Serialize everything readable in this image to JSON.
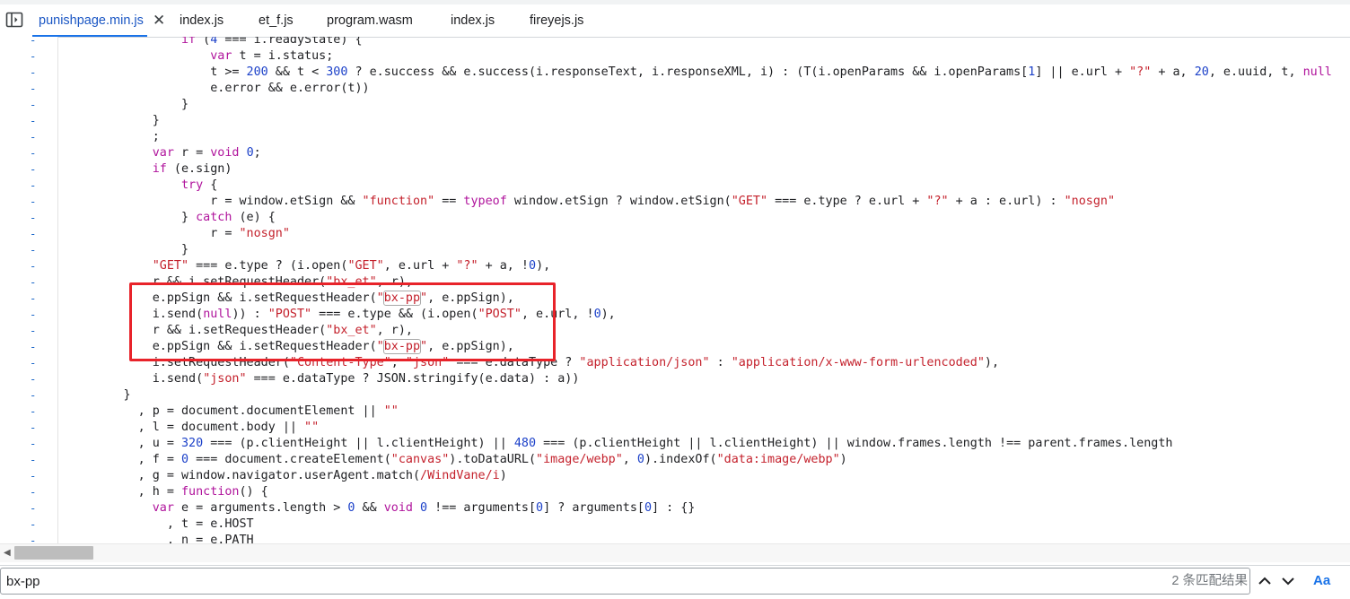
{
  "tabs": [
    {
      "label": "punishpage.min.js",
      "active": true
    },
    {
      "label": "index.js",
      "active": false
    },
    {
      "label": "et_f.js",
      "active": false
    },
    {
      "label": "program.wasm",
      "active": false
    },
    {
      "label": "index.js",
      "active": false
    },
    {
      "label": "fireyejs.js",
      "active": false
    }
  ],
  "tab_close_glyph": "✕",
  "gutter_marker": "-",
  "code_lines": [
    [
      {
        "t": "                ",
        "c": ""
      },
      {
        "t": "if",
        "c": "kw"
      },
      {
        "t": " (",
        "c": ""
      },
      {
        "t": "4",
        "c": "num"
      },
      {
        "t": " === i.readyState) {",
        "c": ""
      }
    ],
    [
      {
        "t": "                    ",
        "c": ""
      },
      {
        "t": "var",
        "c": "kw"
      },
      {
        "t": " t = i.status;",
        "c": ""
      }
    ],
    [
      {
        "t": "                    t >= ",
        "c": ""
      },
      {
        "t": "200",
        "c": "num"
      },
      {
        "t": " && t < ",
        "c": ""
      },
      {
        "t": "300",
        "c": "num"
      },
      {
        "t": " ? e.success && e.success(i.responseText, i.responseXML, i) : (T(i.openParams && i.openParams[",
        "c": ""
      },
      {
        "t": "1",
        "c": "num"
      },
      {
        "t": "] || e.url + ",
        "c": ""
      },
      {
        "t": "\"?\"",
        "c": "str"
      },
      {
        "t": " + a, ",
        "c": ""
      },
      {
        "t": "20",
        "c": "num"
      },
      {
        "t": ", e.uuid, t, ",
        "c": ""
      },
      {
        "t": "null",
        "c": "kw"
      }
    ],
    [
      {
        "t": "                    e.error && e.error(t))",
        "c": ""
      }
    ],
    [
      {
        "t": "                }",
        "c": ""
      }
    ],
    [
      {
        "t": "            }",
        "c": ""
      }
    ],
    [
      {
        "t": "            ;",
        "c": ""
      }
    ],
    [
      {
        "t": "            ",
        "c": ""
      },
      {
        "t": "var",
        "c": "kw"
      },
      {
        "t": " r = ",
        "c": ""
      },
      {
        "t": "void",
        "c": "kw"
      },
      {
        "t": " ",
        "c": ""
      },
      {
        "t": "0",
        "c": "num"
      },
      {
        "t": ";",
        "c": ""
      }
    ],
    [
      {
        "t": "            ",
        "c": ""
      },
      {
        "t": "if",
        "c": "kw"
      },
      {
        "t": " (e.sign)",
        "c": ""
      }
    ],
    [
      {
        "t": "                ",
        "c": ""
      },
      {
        "t": "try",
        "c": "kw"
      },
      {
        "t": " {",
        "c": ""
      }
    ],
    [
      {
        "t": "                    r = window.etSign && ",
        "c": ""
      },
      {
        "t": "\"function\"",
        "c": "str"
      },
      {
        "t": " == ",
        "c": ""
      },
      {
        "t": "typeof",
        "c": "kw"
      },
      {
        "t": " window.etSign ? window.etSign(",
        "c": ""
      },
      {
        "t": "\"GET\"",
        "c": "str"
      },
      {
        "t": " === e.type ? e.url + ",
        "c": ""
      },
      {
        "t": "\"?\"",
        "c": "str"
      },
      {
        "t": " + a : e.url) : ",
        "c": ""
      },
      {
        "t": "\"nosgn\"",
        "c": "str"
      }
    ],
    [
      {
        "t": "                } ",
        "c": ""
      },
      {
        "t": "catch",
        "c": "kw"
      },
      {
        "t": " (e) {",
        "c": ""
      }
    ],
    [
      {
        "t": "                    r = ",
        "c": ""
      },
      {
        "t": "\"nosgn\"",
        "c": "str"
      }
    ],
    [
      {
        "t": "                }",
        "c": ""
      }
    ],
    [
      {
        "t": "            ",
        "c": ""
      },
      {
        "t": "\"GET\"",
        "c": "str"
      },
      {
        "t": " === e.type ? (i.open(",
        "c": ""
      },
      {
        "t": "\"GET\"",
        "c": "str"
      },
      {
        "t": ", e.url + ",
        "c": ""
      },
      {
        "t": "\"?\"",
        "c": "str"
      },
      {
        "t": " + a, !",
        "c": ""
      },
      {
        "t": "0",
        "c": "num"
      },
      {
        "t": "),",
        "c": ""
      }
    ],
    [
      {
        "t": "            r && i.setRequestHeader(",
        "c": ""
      },
      {
        "t": "\"bx_et\"",
        "c": "str"
      },
      {
        "t": ", r),",
        "c": ""
      }
    ],
    [
      {
        "t": "            e.ppSign && i.setRequestHeader(",
        "c": ""
      },
      {
        "t": "\"",
        "c": "str"
      },
      {
        "t": "bx-pp",
        "c": "str match"
      },
      {
        "t": "\"",
        "c": "str"
      },
      {
        "t": ", e.ppSign),",
        "c": ""
      }
    ],
    [
      {
        "t": "            i.send(",
        "c": ""
      },
      {
        "t": "null",
        "c": "kw"
      },
      {
        "t": ")) : ",
        "c": ""
      },
      {
        "t": "\"POST\"",
        "c": "str"
      },
      {
        "t": " === e.type && (i.open(",
        "c": ""
      },
      {
        "t": "\"POST\"",
        "c": "str"
      },
      {
        "t": ", e.url, !",
        "c": ""
      },
      {
        "t": "0",
        "c": "num"
      },
      {
        "t": "),",
        "c": ""
      }
    ],
    [
      {
        "t": "            r && i.setRequestHeader(",
        "c": ""
      },
      {
        "t": "\"bx_et\"",
        "c": "str"
      },
      {
        "t": ", r),",
        "c": ""
      }
    ],
    [
      {
        "t": "            e.ppSign && i.setRequestHeader(",
        "c": ""
      },
      {
        "t": "\"",
        "c": "str"
      },
      {
        "t": "bx-pp",
        "c": "str match"
      },
      {
        "t": "\"",
        "c": "str"
      },
      {
        "t": ", e.ppSign),",
        "c": ""
      }
    ],
    [
      {
        "t": "            i.setRequestHeader(",
        "c": ""
      },
      {
        "t": "\"Content-Type\"",
        "c": "str"
      },
      {
        "t": ", ",
        "c": ""
      },
      {
        "t": "\"json\"",
        "c": "str"
      },
      {
        "t": " === e.dataType ? ",
        "c": ""
      },
      {
        "t": "\"application/json\"",
        "c": "str"
      },
      {
        "t": " : ",
        "c": ""
      },
      {
        "t": "\"application/x-www-form-urlencoded\"",
        "c": "str"
      },
      {
        "t": "),",
        "c": ""
      }
    ],
    [
      {
        "t": "            i.send(",
        "c": ""
      },
      {
        "t": "\"json\"",
        "c": "str"
      },
      {
        "t": " === e.dataType ? JSON.stringify(e.data) : a))",
        "c": ""
      }
    ],
    [
      {
        "t": "        }",
        "c": ""
      }
    ],
    [
      {
        "t": "          , p = document.documentElement || ",
        "c": ""
      },
      {
        "t": "\"\"",
        "c": "str"
      }
    ],
    [
      {
        "t": "          , l = document.body || ",
        "c": ""
      },
      {
        "t": "\"\"",
        "c": "str"
      }
    ],
    [
      {
        "t": "          , u = ",
        "c": ""
      },
      {
        "t": "320",
        "c": "num"
      },
      {
        "t": " === (p.clientHeight || l.clientHeight) || ",
        "c": ""
      },
      {
        "t": "480",
        "c": "num"
      },
      {
        "t": " === (p.clientHeight || l.clientHeight) || window.frames.length !== parent.frames.length",
        "c": ""
      }
    ],
    [
      {
        "t": "          , f = ",
        "c": ""
      },
      {
        "t": "0",
        "c": "num"
      },
      {
        "t": " === document.createElement(",
        "c": ""
      },
      {
        "t": "\"canvas\"",
        "c": "str"
      },
      {
        "t": ").toDataURL(",
        "c": ""
      },
      {
        "t": "\"image/webp\"",
        "c": "str"
      },
      {
        "t": ", ",
        "c": ""
      },
      {
        "t": "0",
        "c": "num"
      },
      {
        "t": ").indexOf(",
        "c": ""
      },
      {
        "t": "\"data:image/webp\"",
        "c": "str"
      },
      {
        "t": ")",
        "c": ""
      }
    ],
    [
      {
        "t": "          , g = window.navigator.userAgent.match(",
        "c": ""
      },
      {
        "t": "/WindVane/i",
        "c": "rx"
      },
      {
        "t": ")",
        "c": ""
      }
    ],
    [
      {
        "t": "          , h = ",
        "c": ""
      },
      {
        "t": "function",
        "c": "kw"
      },
      {
        "t": "() {",
        "c": ""
      }
    ],
    [
      {
        "t": "            ",
        "c": ""
      },
      {
        "t": "var",
        "c": "kw"
      },
      {
        "t": " e = arguments.length > ",
        "c": ""
      },
      {
        "t": "0",
        "c": "num"
      },
      {
        "t": " && ",
        "c": ""
      },
      {
        "t": "void",
        "c": "kw"
      },
      {
        "t": " ",
        "c": ""
      },
      {
        "t": "0",
        "c": "num"
      },
      {
        "t": " !== arguments[",
        "c": ""
      },
      {
        "t": "0",
        "c": "num"
      },
      {
        "t": "] ? arguments[",
        "c": ""
      },
      {
        "t": "0",
        "c": "num"
      },
      {
        "t": "] : {}",
        "c": ""
      }
    ],
    [
      {
        "t": "              , t = e.HOST",
        "c": ""
      }
    ],
    [
      {
        "t": "              , n = e.PATH",
        "c": ""
      }
    ]
  ],
  "search": {
    "value": "bx-pp",
    "match_count": "2 条匹配结果",
    "match_case_label": "Aa"
  },
  "colors": {
    "keyword": "#b0149c",
    "string": "#c4212c",
    "number": "#1c41c9",
    "active_tab": "#1a56c4",
    "annotation_box": "#e8232a"
  }
}
